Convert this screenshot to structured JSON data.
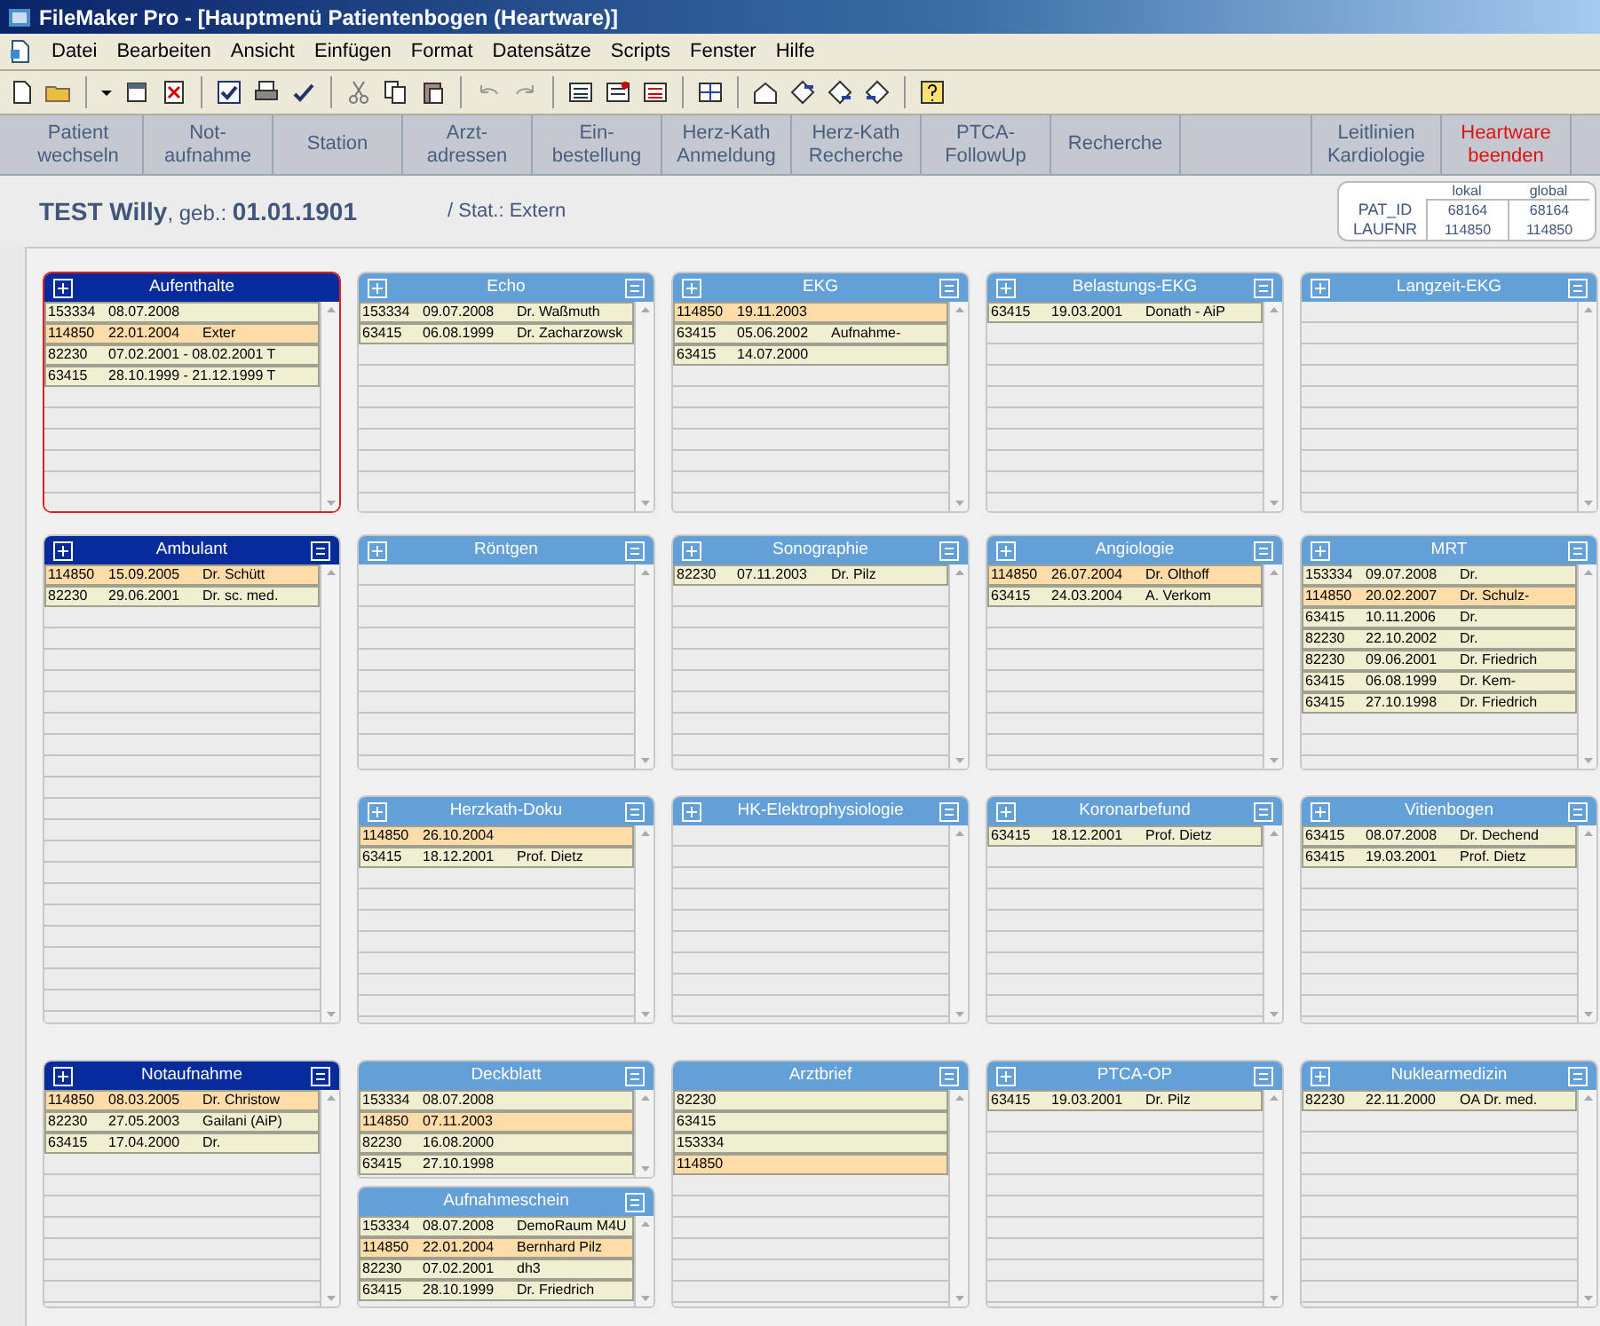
{
  "window": {
    "title": "FileMaker Pro - [Hauptmenü Patientenbogen  (Heartware)]"
  },
  "menu": [
    "Datei",
    "Bearbeiten",
    "Ansicht",
    "Einfügen",
    "Format",
    "Datensätze",
    "Scripts",
    "Fenster",
    "Hilfe"
  ],
  "nav": [
    {
      "lines": [
        "Patient",
        "wechseln"
      ],
      "kind": "normal"
    },
    {
      "lines": [
        "Not-",
        "aufnahme"
      ],
      "kind": "normal"
    },
    {
      "lines": [
        "Station"
      ],
      "kind": "normal"
    },
    {
      "lines": [
        "Arzt-",
        "adressen"
      ],
      "kind": "normal"
    },
    {
      "lines": [
        "Ein-",
        "bestellung"
      ],
      "kind": "normal"
    },
    {
      "lines": [
        "Herz-Kath",
        "Anmeldung"
      ],
      "kind": "normal"
    },
    {
      "lines": [
        "Herz-Kath",
        "Recherche"
      ],
      "kind": "normal"
    },
    {
      "lines": [
        "PTCA-",
        "FollowUp"
      ],
      "kind": "normal"
    },
    {
      "lines": [
        "Recherche"
      ],
      "kind": "normal"
    },
    {
      "lines": [
        "Leitlinien",
        "Kardiologie"
      ],
      "kind": "normal"
    },
    {
      "lines": [
        "Heartware",
        "beenden"
      ],
      "kind": "exit"
    }
  ],
  "patient": {
    "name": "TEST Willy",
    "birth_label": ", geb.:",
    "birth_date": "01.01.1901",
    "status": "/ Stat.: Extern"
  },
  "ids": {
    "columns": [
      "lokal",
      "global"
    ],
    "rows": [
      {
        "label": "PAT_ID",
        "values": [
          "68164",
          "68164"
        ]
      },
      {
        "label": "LAUFNR",
        "values": [
          "114850",
          "114850"
        ]
      }
    ]
  },
  "panels": [
    {
      "title": "Aufenthalte",
      "active": true,
      "focused": true,
      "has_add": true,
      "has_menu": false,
      "entries": [
        {
          "cells": [
            "153334",
            "08.07.2008",
            ""
          ],
          "current": false
        },
        {
          "cells": [
            "114850",
            "22.01.2004",
            "Exter"
          ],
          "current": true
        },
        {
          "cells": [
            "82230",
            "07.02.2001 - 08.02.2001 T",
            ""
          ],
          "current": false
        },
        {
          "cells": [
            "63415",
            "28.10.1999 - 21.12.1999 T",
            ""
          ],
          "current": false
        }
      ]
    },
    {
      "title": "Echo",
      "active": false,
      "focused": false,
      "has_add": true,
      "has_menu": true,
      "entries": [
        {
          "cells": [
            "153334",
            "09.07.2008",
            "Dr. Waßmuth"
          ],
          "current": false
        },
        {
          "cells": [
            "63415",
            "06.08.1999",
            "Dr. Zacharzowsk"
          ],
          "current": false
        }
      ]
    },
    {
      "title": "EKG",
      "active": false,
      "focused": false,
      "has_add": true,
      "has_menu": true,
      "entries": [
        {
          "cells": [
            "114850",
            "19.11.2003",
            ""
          ],
          "current": true
        },
        {
          "cells": [
            "63415",
            "05.06.2002",
            "Aufnahme-"
          ],
          "current": false
        },
        {
          "cells": [
            "63415",
            "14.07.2000",
            ""
          ],
          "current": false
        }
      ]
    },
    {
      "title": "Belastungs-EKG",
      "active": false,
      "focused": false,
      "has_add": true,
      "has_menu": true,
      "entries": [
        {
          "cells": [
            "63415",
            "19.03.2001",
            "Donath - AiP"
          ],
          "current": false
        }
      ]
    },
    {
      "title": "Langzeit-EKG",
      "active": false,
      "focused": false,
      "has_add": true,
      "has_menu": true
    },
    {
      "title": "Ambulant",
      "active": true,
      "focused": false,
      "has_add": true,
      "has_menu": true,
      "entries": [
        {
          "cells": [
            "114850",
            "15.09.2005",
            "Dr. Schütt"
          ],
          "current": true
        },
        {
          "cells": [
            "82230",
            "29.06.2001",
            "Dr. sc. med."
          ],
          "current": false
        }
      ]
    },
    {
      "title": "Röntgen",
      "active": false,
      "focused": false,
      "has_add": true,
      "has_menu": true
    },
    {
      "title": "Sonographie",
      "active": false,
      "focused": false,
      "has_add": true,
      "has_menu": true,
      "entries": [
        {
          "cells": [
            "82230",
            "07.11.2003",
            "Dr. Pilz"
          ],
          "current": false
        }
      ]
    },
    {
      "title": "Angiologie",
      "active": false,
      "focused": false,
      "has_add": true,
      "has_menu": true,
      "entries": [
        {
          "cells": [
            "114850",
            "26.07.2004",
            "Dr. Olthoff"
          ],
          "current": true
        },
        {
          "cells": [
            "63415",
            "24.03.2004",
            "A. Verkom"
          ],
          "current": false
        }
      ]
    },
    {
      "title": "MRT",
      "active": false,
      "focused": false,
      "has_add": true,
      "has_menu": true,
      "entries": [
        {
          "cells": [
            "153334",
            "09.07.2008",
            "Dr."
          ],
          "current": false
        },
        {
          "cells": [
            "114850",
            "20.02.2007",
            "Dr. Schulz-"
          ],
          "current": true
        },
        {
          "cells": [
            "63415",
            "10.11.2006",
            "Dr."
          ],
          "current": false
        },
        {
          "cells": [
            "82230",
            "22.10.2002",
            "Dr."
          ],
          "current": false
        },
        {
          "cells": [
            "82230",
            "09.06.2001",
            "Dr. Friedrich"
          ],
          "current": false
        },
        {
          "cells": [
            "63415",
            "06.08.1999",
            "Dr. Kem-"
          ],
          "current": false
        },
        {
          "cells": [
            "63415",
            "27.10.1998",
            "Dr. Friedrich"
          ],
          "current": false
        }
      ]
    },
    {
      "title": "Herzkath-Doku",
      "active": false,
      "focused": false,
      "has_add": true,
      "has_menu": true,
      "entries": [
        {
          "cells": [
            "114850",
            "26.10.2004",
            ""
          ],
          "current": true
        },
        {
          "cells": [
            "63415",
            "18.12.2001",
            "Prof. Dietz"
          ],
          "current": false
        }
      ]
    },
    {
      "title": "HK-Elektrophysiologie",
      "active": false,
      "focused": false,
      "has_add": true,
      "has_menu": true
    },
    {
      "title": "Koronarbefund",
      "active": false,
      "focused": false,
      "has_add": true,
      "has_menu": true,
      "entries": [
        {
          "cells": [
            "63415",
            "18.12.2001",
            "Prof. Dietz"
          ],
          "current": false
        }
      ]
    },
    {
      "title": "Vitienbogen",
      "active": false,
      "focused": false,
      "has_add": true,
      "has_menu": true,
      "entries": [
        {
          "cells": [
            "63415",
            "08.07.2008",
            "Dr. Dechend"
          ],
          "current": false
        },
        {
          "cells": [
            "63415",
            "19.03.2001",
            "Prof. Dietz"
          ],
          "current": false
        }
      ]
    },
    {
      "title": "Notaufnahme",
      "active": true,
      "focused": false,
      "has_add": true,
      "has_menu": true,
      "entries": [
        {
          "cells": [
            "114850",
            "08.03.2005",
            "Dr. Christow"
          ],
          "current": true
        },
        {
          "cells": [
            "82230",
            "27.05.2003",
            "Gailani (AiP)"
          ],
          "current": false
        },
        {
          "cells": [
            "63415",
            "17.04.2000",
            "Dr."
          ],
          "current": false
        }
      ]
    },
    {
      "title": "Deckblatt",
      "active": false,
      "focused": false,
      "has_add": false,
      "has_menu": true,
      "entries": [
        {
          "cells": [
            "153334",
            "08.07.2008",
            ""
          ],
          "current": false
        },
        {
          "cells": [
            "114850",
            "07.11.2003",
            ""
          ],
          "current": true
        },
        {
          "cells": [
            "82230",
            "16.08.2000",
            ""
          ],
          "current": false
        },
        {
          "cells": [
            "63415",
            "27.10.1998",
            ""
          ],
          "current": false
        }
      ]
    },
    {
      "title": "Aufnahmeschein",
      "active": false,
      "focused": false,
      "has_add": false,
      "has_menu": true,
      "entries": [
        {
          "cells": [
            "153334",
            "08.07.2008",
            "DemoRaum M4U"
          ],
          "current": false
        },
        {
          "cells": [
            "114850",
            "22.01.2004",
            "Bernhard Pilz"
          ],
          "current": true
        },
        {
          "cells": [
            "82230",
            "07.02.2001",
            "dh3"
          ],
          "current": false
        },
        {
          "cells": [
            "63415",
            "28.10.1999",
            "Dr. Friedrich"
          ],
          "current": false
        }
      ]
    },
    {
      "title": "Arztbrief",
      "active": false,
      "focused": false,
      "has_add": false,
      "has_menu": true,
      "entries": [
        {
          "cells": [
            "82230",
            "",
            ""
          ],
          "current": false
        },
        {
          "cells": [
            "63415",
            "",
            ""
          ],
          "current": false
        },
        {
          "cells": [
            "153334",
            "",
            ""
          ],
          "current": false
        },
        {
          "cells": [
            "114850",
            "",
            ""
          ],
          "current": true
        }
      ]
    },
    {
      "title": "PTCA-OP",
      "active": false,
      "focused": false,
      "has_add": true,
      "has_menu": true,
      "entries": [
        {
          "cells": [
            "63415",
            "19.03.2001",
            "Dr. Pilz"
          ],
          "current": false
        }
      ]
    },
    {
      "title": "Nuklearmedizin",
      "active": false,
      "focused": false,
      "has_add": true,
      "has_menu": true,
      "entries": [
        {
          "cells": [
            "82230",
            "22.11.2000",
            "OA Dr. med."
          ],
          "current": false
        }
      ]
    }
  ]
}
